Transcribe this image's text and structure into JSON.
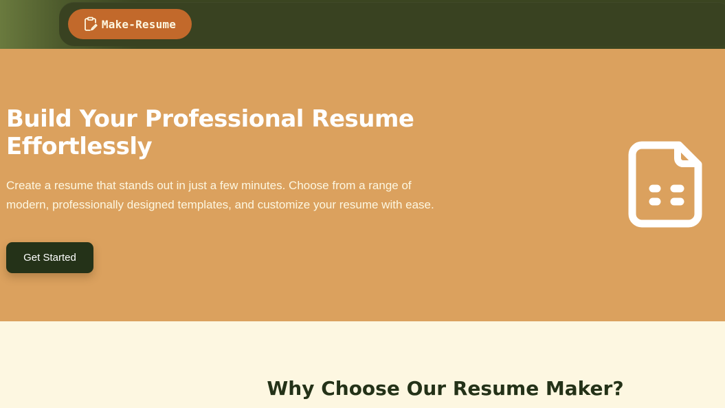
{
  "nav": {
    "brand_label": "Make-Resume",
    "brand_icon": "clipboard-edit-icon",
    "brand_color": "#c2692b"
  },
  "hero": {
    "title": "Build Your Professional Resume Effortlessly",
    "description": "Create a resume that stands out in just a few minutes. Choose from a range of modern, professionally designed templates, and customize your resume with ease.",
    "cta_label": "Get Started",
    "illustration_icon": "document-icon",
    "background_color": "#dba15e",
    "cta_color": "#243218"
  },
  "features": {
    "title": "Why Choose Our Resume Maker?"
  }
}
